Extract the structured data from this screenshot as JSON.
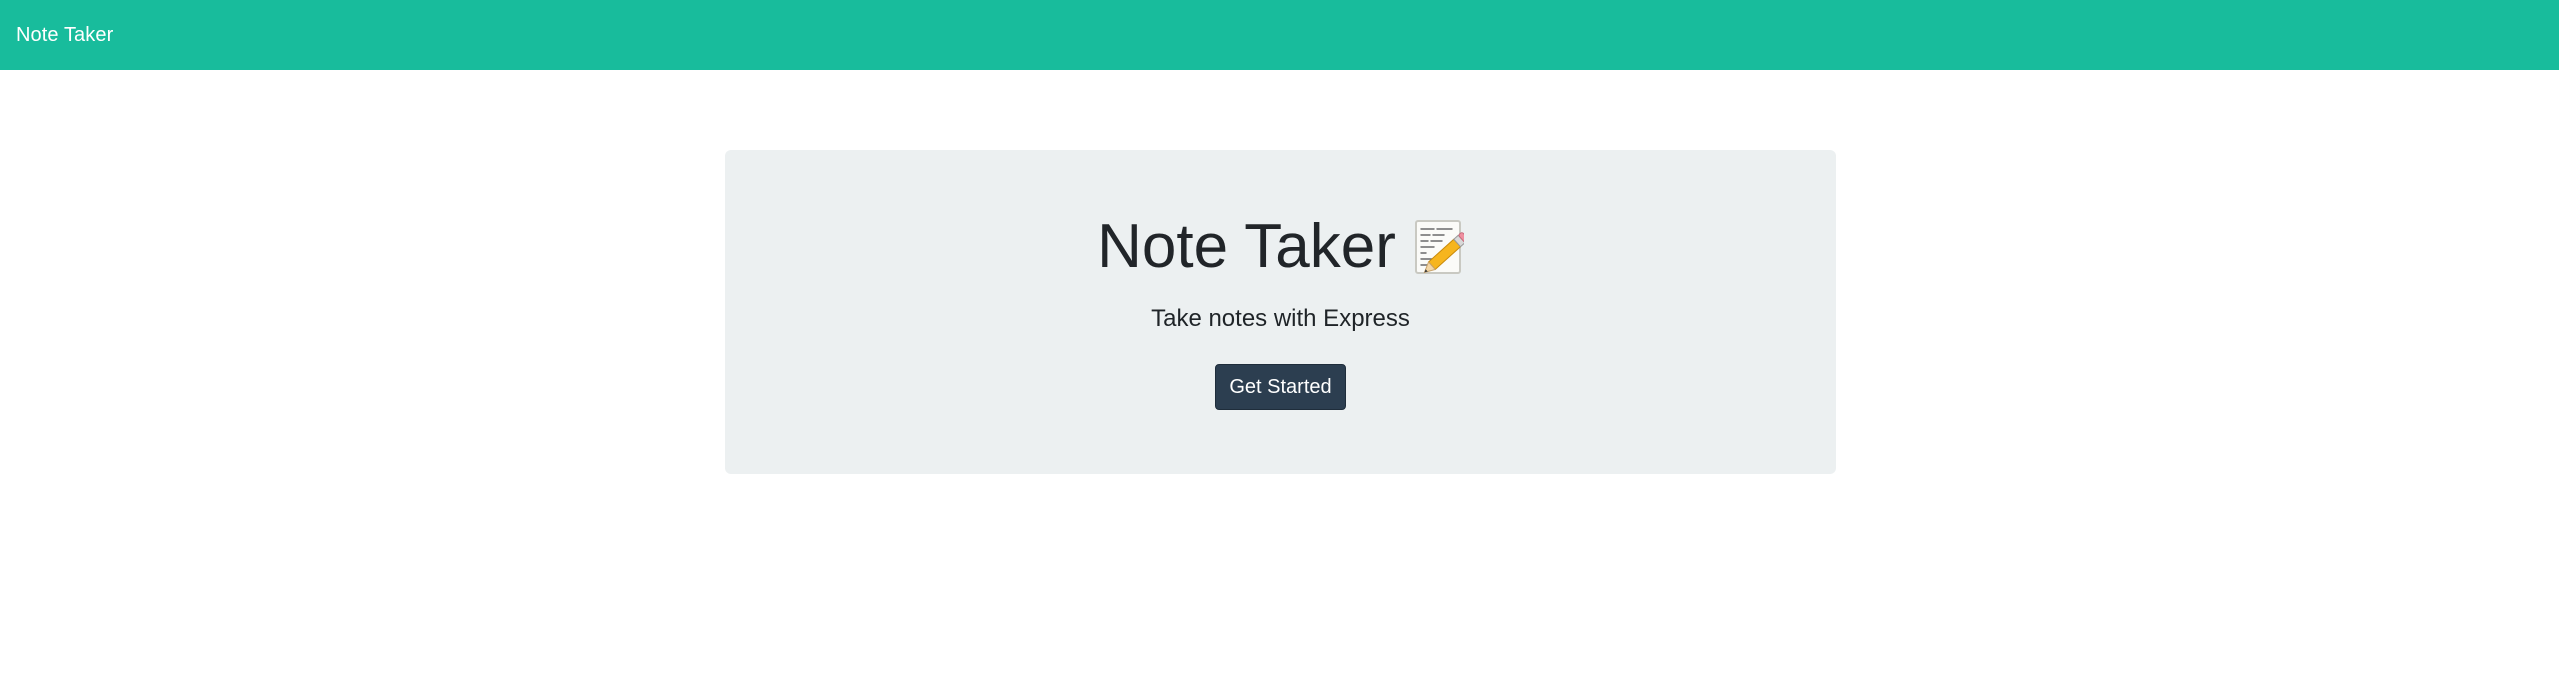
{
  "navbar": {
    "brand": "Note Taker",
    "background": "#18bc9c"
  },
  "hero": {
    "title": "Note Taker",
    "title_icon": "memo-pencil-icon",
    "subtitle": "Take notes with Express",
    "cta_label": "Get Started",
    "background": "#ecf0f1",
    "button_color": "#2c3e50"
  }
}
